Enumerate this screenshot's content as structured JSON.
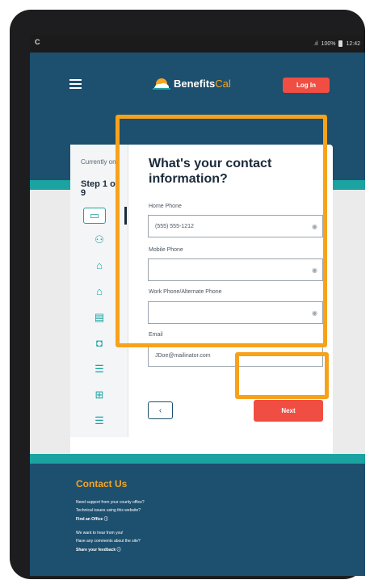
{
  "status_bar": {
    "app_icon": "C",
    "signal": ".ıl",
    "battery": "100%",
    "time": "12:42"
  },
  "header": {
    "logo_main": "Benefits",
    "logo_accent": "Cal",
    "login_label": "Log In"
  },
  "stepper": {
    "currently_label": "Currently on",
    "step_label": "Step 1 of 9",
    "icons": [
      "id-card-icon",
      "people-icon",
      "house-icon",
      "house-money-icon",
      "document-icon",
      "car-icon",
      "list-icon",
      "document-plus-icon",
      "summary-icon"
    ]
  },
  "form": {
    "title": "What's your contact information?",
    "home_phone_label": "Home Phone",
    "home_phone_value": "(555) 555-1212",
    "mobile_phone_label": "Mobile Phone",
    "mobile_phone_value": "",
    "work_phone_label": "Work Phone/Alternate Phone",
    "work_phone_value": "",
    "email_label": "Email",
    "email_value": "JDoe@mailinator.com"
  },
  "buttons": {
    "back": "‹",
    "next": "Next"
  },
  "footer": {
    "title": "Contact Us",
    "line1": "Need support from your county office?",
    "line2": "Technical issues using this website?",
    "line3": "Find an Office ⓘ",
    "line4": "We want to hear from you!",
    "line5": "Have any comments about the site?",
    "line6": "Share your feedback ⓘ"
  },
  "colors": {
    "navy": "#1d4f6e",
    "teal": "#1aa3a0",
    "red": "#f04e43",
    "orange": "#f6a623",
    "highlight": "#f7a21b"
  }
}
